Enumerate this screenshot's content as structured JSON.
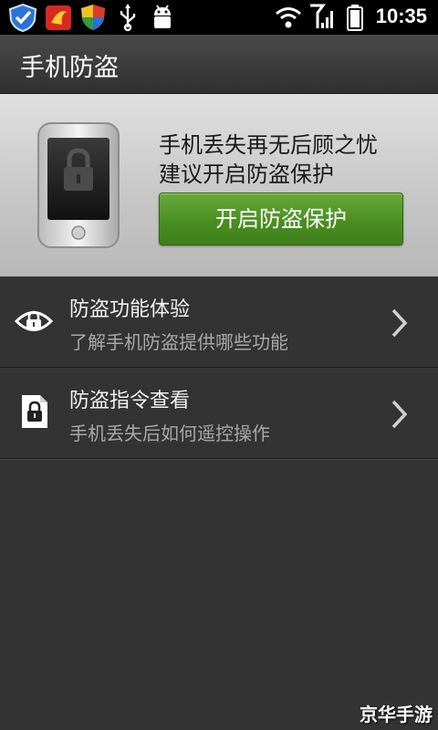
{
  "status_bar": {
    "time": "10:35",
    "icons": [
      "shield-check-icon",
      "app-notification-icon",
      "antivirus-shield-icon",
      "usb-icon",
      "android-debug-icon",
      "wifi-icon",
      "signal-icon",
      "battery-icon"
    ]
  },
  "header": {
    "title": "手机防盗"
  },
  "banner": {
    "line1": "手机丢失再无后顾之忧",
    "line2": "建议开启防盗保护",
    "button_label": "开启防盗保护",
    "button_color": "#4a8f22"
  },
  "list": {
    "items": [
      {
        "title": "防盗功能体验",
        "subtitle": "了解手机防盗提供哪些功能",
        "icon": "lock-eye-icon"
      },
      {
        "title": "防盗指令查看",
        "subtitle": "手机丢失后如何遥控操作",
        "icon": "lock-document-icon"
      }
    ]
  },
  "watermark": "京华手游"
}
